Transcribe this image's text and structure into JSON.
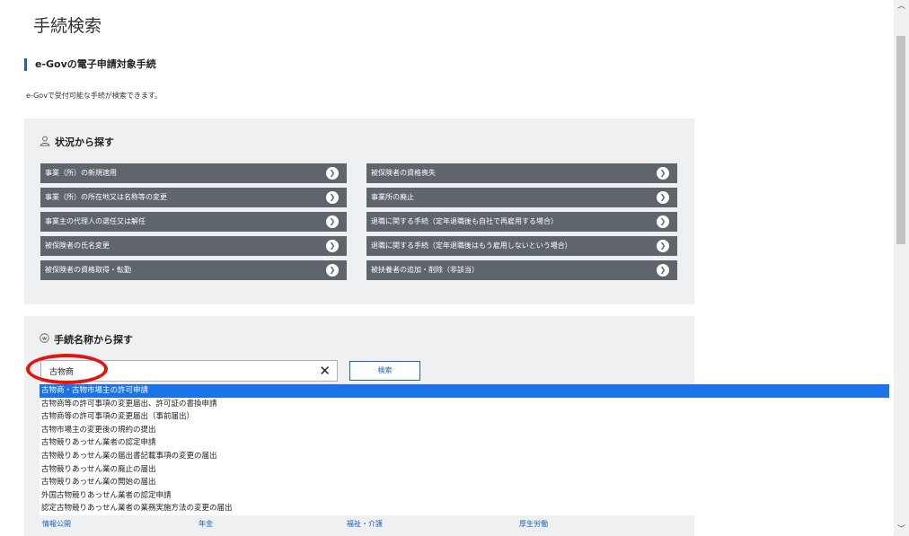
{
  "page": {
    "title": "手続検索",
    "section_title": "e-Govの電子申請対象手続",
    "description": "e-Govで受付可能な手続が検索できます。"
  },
  "status_search": {
    "title": "状況から探す",
    "icon": "person-icon",
    "left_items": [
      "事業（所）の新規適用",
      "事業（所）の所在地又は名称等の変更",
      "事業主の代理人の選任又は解任",
      "被保険者の氏名変更",
      "被保険者の資格取得・転勤"
    ],
    "right_items": [
      "被保険者の資格喪失",
      "事業所の廃止",
      "退職に関する手続（定年退職後も自社で再雇用する場合）",
      "退職に関する手続（定年退職後はもう雇用しないという場合）",
      "被扶養者の追加・削除（非該当）"
    ]
  },
  "name_search": {
    "title": "手続名称から探す",
    "icon": "w-circle-icon",
    "input_value": "古物商",
    "clear_label": "✕",
    "search_button_label": "検索",
    "suggestions": [
      "古物商・古物市場主の許可申請",
      "古物商等の許可事項の変更届出、許可証の書換申請",
      "古物商等の許可事項の変更届出（事前届出）",
      "古物市場主の変更後の規約の提出",
      "古物競りあっせん業者の認定申請",
      "古物競りあっせん業の届出書記載事項の変更の届出",
      "古物競りあっせん業の廃止の届出",
      "古物競りあっせん業の開始の届出",
      "外国古物競りあっせん業者の認定申請",
      "認定古物競りあっせん業者の業務実施方法の変更の届出"
    ],
    "selected_index": 0
  },
  "footer_links": [
    "情報公開",
    "年金",
    "福祉・介護",
    "厚生労働"
  ],
  "colors": {
    "accent": "#1c64c4",
    "situation_button": "#5e656c",
    "panel_bg": "#eef0f2",
    "selected_suggestion": "#1a73e8",
    "highlight_ring": "#e4140c"
  }
}
